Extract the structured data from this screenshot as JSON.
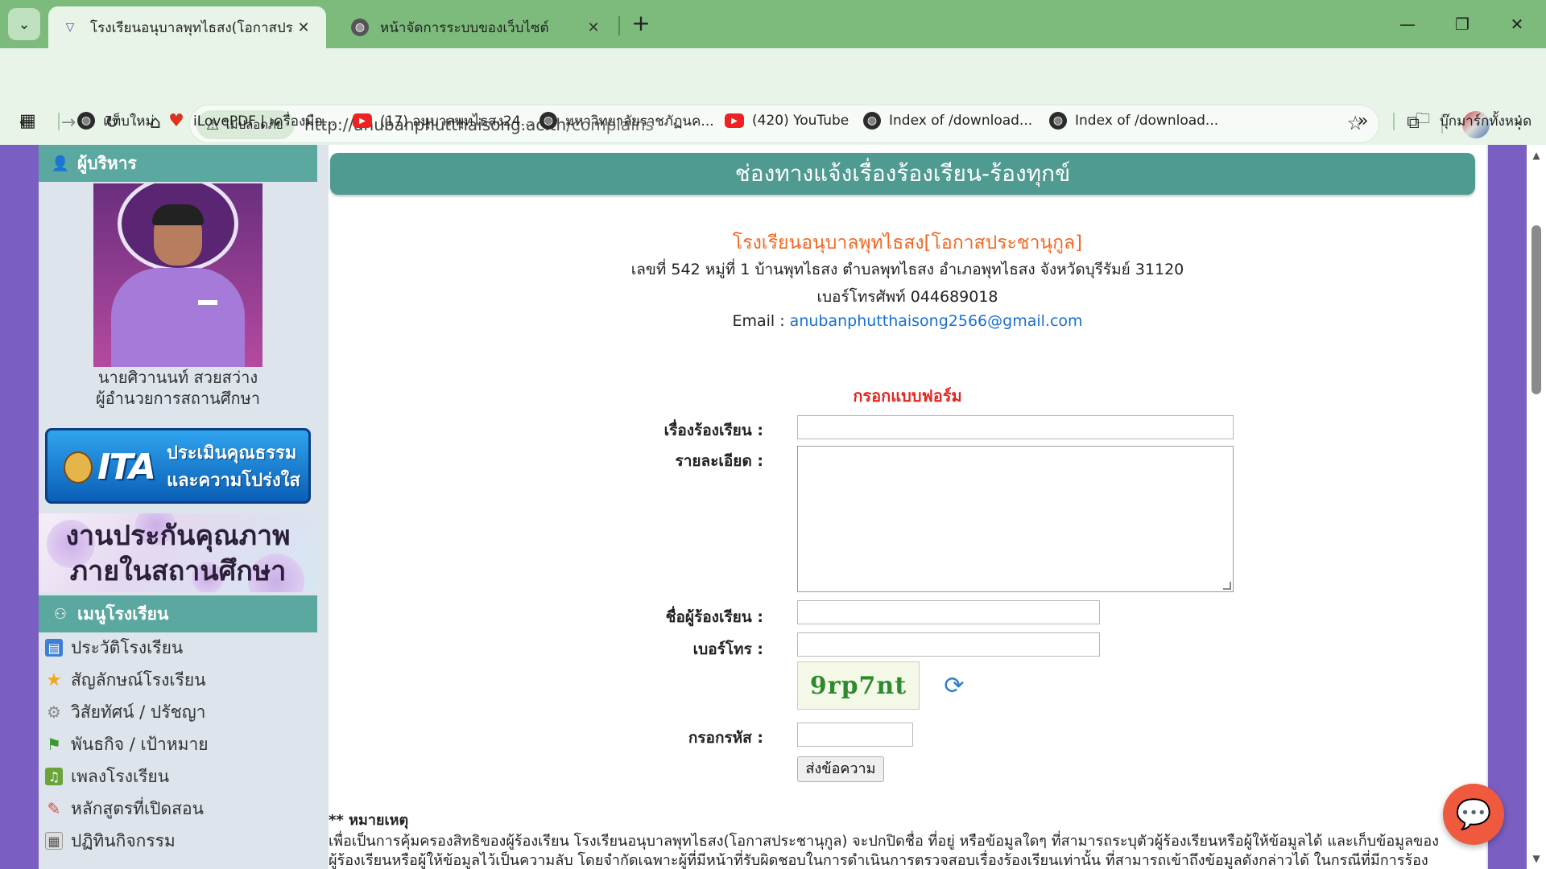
{
  "browser": {
    "tabs": [
      {
        "title": "โรงเรียนอนุบาลพุทไธสง(โอกาสประช",
        "active": true
      },
      {
        "title": "หน้าจัดการระบบของเว็บไซต์",
        "active": false
      }
    ],
    "new_tab": "+",
    "security_label": "ไม่ปลอดภัย",
    "url_host": "http://anubanphutthaisong.ac.th",
    "url_path": "/complains",
    "bookmarks": [
      {
        "label": "แท็บใหม่",
        "icon": "globe-icon"
      },
      {
        "label": "iLovePDF | เครื่องมือ...",
        "icon": "heart-icon"
      },
      {
        "label": "(17) อนุบาลพุทไธสง24...",
        "icon": "youtube-icon"
      },
      {
        "label": "มหาวิทยาลัยราชภัฏนค...",
        "icon": "globe-icon"
      },
      {
        "label": "(420) YouTube",
        "icon": "youtube-icon"
      },
      {
        "label": "Index of /download...",
        "icon": "globe-icon"
      },
      {
        "label": "Index of /download...",
        "icon": "globe-icon"
      }
    ],
    "all_bookmarks": "บุ๊กมาร์กทั้งหมด"
  },
  "sidebar": {
    "admin_heading": "ผู้บริหาร",
    "admin_name": "นายศิวานนท์ สวยสว่าง",
    "admin_position": "ผู้อำนวยการสถานศึกษา",
    "ita_logo_text": "ITA",
    "ita_banner": [
      "ประเมินคุณธรรม",
      "และความโปร่งใส"
    ],
    "qa_banner": [
      "งานประกันคุณภาพ",
      "ภายในสถานศึกษา"
    ],
    "menu_heading": "เมนูโรงเรียน",
    "menu_items": [
      {
        "label": "ประวัติโรงเรียน",
        "icon": "book-icon"
      },
      {
        "label": "สัญลักษณ์โรงเรียน",
        "icon": "star-icon"
      },
      {
        "label": "วิสัยทัศน์ / ปรัชญา",
        "icon": "gear-icon"
      },
      {
        "label": "พันธกิจ / เป้าหมาย",
        "icon": "flag-icon"
      },
      {
        "label": "เพลงโรงเรียน",
        "icon": "music-icon"
      },
      {
        "label": "หลักสูตรที่เปิดสอน",
        "icon": "pencil-icon"
      },
      {
        "label": "ปฏิทินกิจกรรม",
        "icon": "calendar-icon"
      }
    ]
  },
  "main": {
    "title": "ช่องทางแจ้งเรื่องร้องเรียน-ร้องทุกข์",
    "school_name": "โรงเรียนอนุบาลพุทไธสง[โอกาสประชานุกูล]",
    "address": "เลขที่ 542 หมู่ที่ 1 บ้านพุทไธสง   ตำบลพุทไธสง  อำเภอพุทไธสง จังหวัดบุรีรัมย์ 31120",
    "phone": "เบอร์โทรศัพท์ 044689018",
    "email_label": "Email : ",
    "email": "anubanphutthaisong2566@gmail.com",
    "form_title": "กรอกแบบฟอร์ม",
    "labels": {
      "subject": "เรื่องร้องเรียน :",
      "detail": "รายละเอียด :",
      "name": "ชื่อผู้ร้องเรียน :",
      "phone": "เบอร์โทร :",
      "code": "กรอกรหัส :"
    },
    "captcha_text": "9rp7nt",
    "submit_label": "ส่งข้อความ",
    "note_heading": "** หมายเหตุ",
    "note_lines": [
      "เพื่อเป็นการคุ้มครองสิทธิของผู้ร้องเรียน โรงเรียนอนุบาลพุทไธสง(โอกาสประชานุกูล) จะปกปิดชื่อ ที่อยู่ หรือข้อมูลใดๆ ที่สามารถระบุตัวผู้ร้องเรียนหรือผู้ให้ข้อมูลได้ และเก็บข้อมูลของ",
      "ผู้ร้องเรียนหรือผู้ให้ข้อมูลไว้เป็นความลับ โดยจำกัดเฉพาะผู้ที่มีหน้าที่รับผิดชอบในการดำเนินการตรวจสอบเรื่องร้องเรียนเท่านั้น ที่สามารถเข้าถึงข้อมูลดังกล่าวได้ ในกรณีที่มีการร้อง"
    ]
  },
  "colors": {
    "accent_teal": "#5aa89f",
    "school_name": "#f26722",
    "form_title": "#e4261f",
    "link": "#1a6fd0",
    "chat_button": "#ef5a3f"
  }
}
